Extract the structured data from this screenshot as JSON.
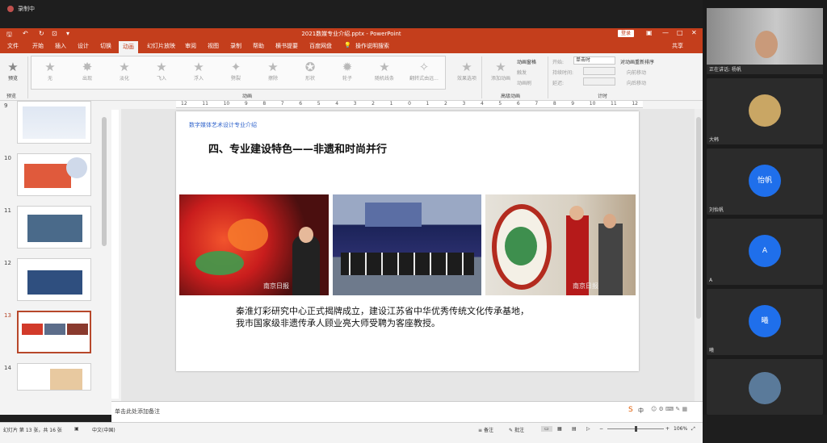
{
  "recording": {
    "label": "录制中"
  },
  "window": {
    "title": "2021数媒专业介绍.pptx  -  PowerPoint",
    "login": "登录",
    "share": "共享",
    "min": "—",
    "max": "□",
    "close": "✕"
  },
  "menu": {
    "items": [
      "文件",
      "开始",
      "插入",
      "设计",
      "切换",
      "动画",
      "幻灯片放映",
      "审阅",
      "视图",
      "录制",
      "帮助",
      "横书提要",
      "百度网盘"
    ],
    "active": "动画",
    "search": "操作说明搜索"
  },
  "ribbon": {
    "preview": "预览",
    "preview_group": "预览",
    "animations": [
      "无",
      "出现",
      "淡化",
      "飞入",
      "浮入",
      "劈裂",
      "擦除",
      "形状",
      "轮子",
      "随机线条",
      "翻转式由远..."
    ],
    "effect_options": "效果选项",
    "animation_group": "动画",
    "add_animation": "添加动画",
    "animation_pane": "动画窗格",
    "trigger": "触发",
    "animation_painter": "动画刷",
    "advanced_group": "高级动画",
    "start_label": "开始:",
    "start_value": "单击时",
    "duration_label": "持续时间:",
    "delay_label": "延迟:",
    "reorder": "对动画重新排序",
    "move_earlier": "向前移动",
    "move_later": "向后移动",
    "timing_group": "计时"
  },
  "thumbnails": {
    "numbers": [
      "9",
      "10",
      "11",
      "12",
      "13",
      "14"
    ],
    "selected": "13"
  },
  "ruler": {
    "ticks": [
      "12",
      "11",
      "10",
      "9",
      "8",
      "7",
      "6",
      "5",
      "4",
      "3",
      "2",
      "1",
      "0",
      "1",
      "2",
      "3",
      "4",
      "5",
      "6",
      "7",
      "8",
      "9",
      "10",
      "11",
      "12"
    ]
  },
  "slide": {
    "header": "数字媒体艺术设计专业介绍",
    "headline": "四、专业建设特色——非遗和时尚并行",
    "caption_line1": "秦淮灯彩研究中心正式揭牌成立，建设江苏省中华优秀传统文化传承基地，",
    "caption_line2": "我市国家级非遗传承人顾业亮大师受聘为客座教授。",
    "watermark": "南京日报"
  },
  "notes": {
    "placeholder": "单击此处添加备注"
  },
  "status": {
    "slide_info": "幻灯片 第 13 张，共 16 张",
    "language": "中文(中国)",
    "notes_btn": "备注",
    "comments_btn": "批注",
    "zoom": "106%",
    "ime": "中"
  },
  "participants": [
    {
      "name": "正在讲话: 杨帆",
      "initial": "",
      "color": "#6b6b6b"
    },
    {
      "name": "大韩",
      "initial": "",
      "color": "#c9a664"
    },
    {
      "name": "刘怡帆",
      "initial": "怡帆",
      "color": "#1f6feb"
    },
    {
      "name": "A",
      "initial": "A",
      "color": "#1f6feb"
    },
    {
      "name": "曦",
      "initial": "曦",
      "color": "#1f6feb"
    },
    {
      "name": "",
      "initial": "",
      "color": "#5a7a9a"
    }
  ],
  "colors": {
    "ppt_red": "#c43e1c",
    "accent_blue": "#1f6feb"
  }
}
